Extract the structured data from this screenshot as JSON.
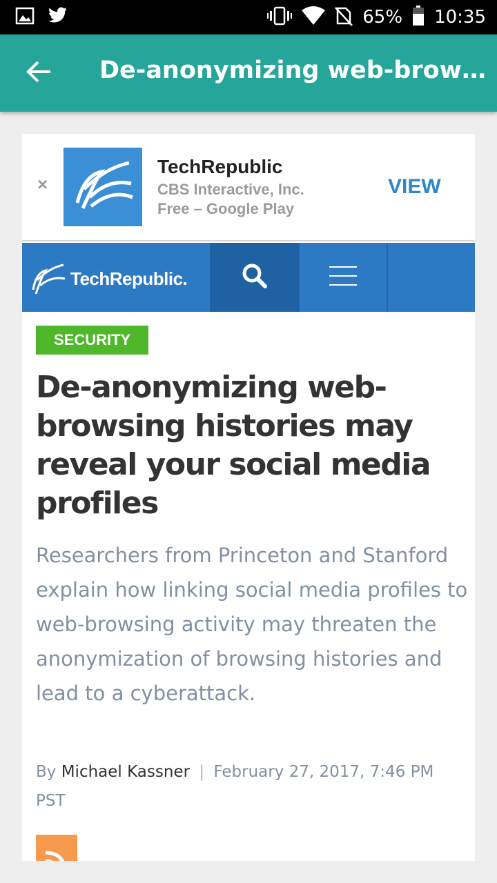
{
  "status_bar": {
    "battery": "65%",
    "time": "10:35",
    "icons": [
      "image-icon",
      "twitter-icon",
      "vibrate-icon",
      "wifi-icon",
      "no-sim-icon",
      "battery-icon"
    ]
  },
  "toolbar": {
    "title": "De-anonymizing web-browsin…",
    "color": "#26a69a"
  },
  "ad": {
    "close": "×",
    "app_name": "TechRepublic",
    "publisher": "CBS Interactive, Inc.",
    "store": "Free – Google Play",
    "cta": "VIEW",
    "icon_color": "#3a8fd6"
  },
  "site_nav": {
    "brand": "TechRepublic.",
    "color": "#2c79c4"
  },
  "article": {
    "category": "SECURITY",
    "headline": "De-anonymizing web-browsing histories may reveal your social media profiles",
    "dek": "Researchers from Princeton and Stanford explain how linking social media profiles to web-browsing activity may threaten the anonymization of browsing histories and lead to a cyberattack.",
    "by_label": "By",
    "author": "Michael Kassner",
    "separator": "|",
    "date": "February 27, 2017, 7:46 PM PST"
  }
}
